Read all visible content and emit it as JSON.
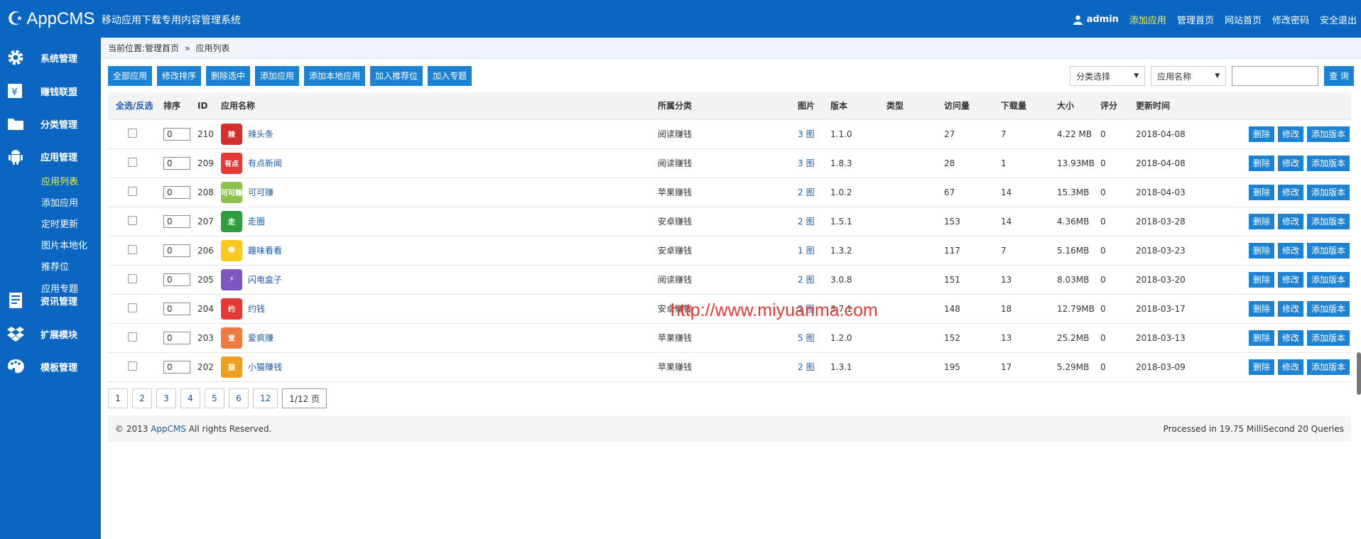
{
  "header": {
    "logo": "AppCMS",
    "subtitle": "移动应用下载专用内容管理系统",
    "user": "admin",
    "nav": [
      {
        "label": "添加应用",
        "active": true
      },
      {
        "label": "管理首页",
        "active": false
      },
      {
        "label": "网站首页",
        "active": false
      },
      {
        "label": "修改密码",
        "active": false
      },
      {
        "label": "安全退出",
        "active": false
      }
    ]
  },
  "sidebar": {
    "groups": [
      {
        "label": "系统管理",
        "icon": "gear-icon"
      },
      {
        "label": "赚钱联盟",
        "icon": "money-icon"
      },
      {
        "label": "分类管理",
        "icon": "folder-icon"
      },
      {
        "label": "应用管理",
        "icon": "android-icon"
      },
      {
        "label": "资讯管理",
        "icon": "news-icon"
      },
      {
        "label": "扩展模块",
        "icon": "dropbox-icon"
      },
      {
        "label": "模板管理",
        "icon": "palette-icon"
      }
    ],
    "sub_items": [
      {
        "label": "应用列表",
        "active": true
      },
      {
        "label": "添加应用",
        "active": false
      },
      {
        "label": "定时更新",
        "active": false
      },
      {
        "label": "图片本地化",
        "active": false
      },
      {
        "label": "推荐位",
        "active": false
      },
      {
        "label": "应用专题",
        "active": false
      }
    ]
  },
  "breadcrumb": {
    "prefix": "当前位置:",
    "home": "管理首页",
    "sep": "»",
    "current": "应用列表"
  },
  "toolbar": [
    "全部应用",
    "修改排序",
    "删除选中",
    "添加应用",
    "添加本地应用",
    "加入推荐位",
    "加入专题"
  ],
  "filters": {
    "category": "分类选择",
    "field": "应用名称",
    "search_button": "查 询"
  },
  "table": {
    "headers": {
      "select": "全选/反选",
      "order": "排序",
      "id": "ID",
      "name": "应用名称",
      "category": "所属分类",
      "images": "图片",
      "version": "版本",
      "type": "类型",
      "views": "访问量",
      "downloads": "下载量",
      "size": "大小",
      "rating": "评分",
      "updated": "更新时间"
    },
    "img_unit": "图",
    "ops": [
      "删除",
      "修改",
      "添加版本"
    ],
    "rows": [
      {
        "order": "0",
        "id": "210",
        "name": "辣头条",
        "icon_text": "辣",
        "icon_color": "#d32f2f",
        "category": "阅读赚钱",
        "images": "3",
        "version": "1.1.0",
        "type": "",
        "views": "27",
        "downloads": "7",
        "size": "4.22 MB",
        "rating": "0",
        "updated": "2018-04-08"
      },
      {
        "order": "0",
        "id": "209",
        "name": "有点新闻",
        "icon_text": "有点",
        "icon_color": "#e53935",
        "category": "阅读赚钱",
        "images": "3",
        "version": "1.8.3",
        "type": "",
        "views": "28",
        "downloads": "1",
        "size": "13.93MB",
        "rating": "0",
        "updated": "2018-04-08"
      },
      {
        "order": "0",
        "id": "208",
        "name": "可可赚",
        "icon_text": "可可赚",
        "icon_color": "#8bc34a",
        "category": "苹果赚钱",
        "images": "2",
        "version": "1.0.2",
        "type": "",
        "views": "67",
        "downloads": "14",
        "size": "15.3MB",
        "rating": "0",
        "updated": "2018-04-03"
      },
      {
        "order": "0",
        "id": "207",
        "name": "走圈",
        "icon_text": "走",
        "icon_color": "#2e9e3e",
        "category": "安卓赚钱",
        "images": "2",
        "version": "1.5.1",
        "type": "",
        "views": "153",
        "downloads": "14",
        "size": "4.36MB",
        "rating": "0",
        "updated": "2018-03-28"
      },
      {
        "order": "0",
        "id": "206",
        "name": "趣味看看",
        "icon_text": "☻",
        "icon_color": "#f9c923",
        "category": "安卓赚钱",
        "images": "1",
        "version": "1.3.2",
        "type": "",
        "views": "117",
        "downloads": "7",
        "size": "5.16MB",
        "rating": "0",
        "updated": "2018-03-23"
      },
      {
        "order": "0",
        "id": "205",
        "name": "闪电盒子",
        "icon_text": "⚡",
        "icon_color": "#7e57c2",
        "category": "阅读赚钱",
        "images": "2",
        "version": "3.0.8",
        "type": "",
        "views": "151",
        "downloads": "13",
        "size": "8.03MB",
        "rating": "0",
        "updated": "2018-03-20"
      },
      {
        "order": "0",
        "id": "204",
        "name": "约钱",
        "icon_text": "约",
        "icon_color": "#e53935",
        "category": "安卓赚钱",
        "images": "2",
        "version": "3.7.1",
        "type": "",
        "views": "148",
        "downloads": "18",
        "size": "12.79MB",
        "rating": "0",
        "updated": "2018-03-17"
      },
      {
        "order": "0",
        "id": "203",
        "name": "爱疯赚",
        "icon_text": "爱",
        "icon_color": "#ef7b3e",
        "category": "苹果赚钱",
        "images": "5",
        "version": "1.2.0",
        "type": "",
        "views": "152",
        "downloads": "13",
        "size": "25.2MB",
        "rating": "0",
        "updated": "2018-03-13"
      },
      {
        "order": "0",
        "id": "202",
        "name": "小猫赚钱",
        "icon_text": "猫",
        "icon_color": "#f0a020",
        "category": "苹果赚钱",
        "images": "2",
        "version": "1.3.1",
        "type": "",
        "views": "195",
        "downloads": "17",
        "size": "5.29MB",
        "rating": "0",
        "updated": "2018-03-09"
      }
    ]
  },
  "pagination": {
    "pages": [
      "1",
      "2",
      "3",
      "4",
      "5",
      "6",
      "12"
    ],
    "current": "1",
    "info": "1/12 页"
  },
  "footer": {
    "copyright": "© 2013",
    "brand": "AppCMS",
    "rights": "All rights Reserved.",
    "stats": "Processed in 19.75 MilliSecond 20 Queries"
  },
  "watermark": "http://www.miyuanma.com"
}
